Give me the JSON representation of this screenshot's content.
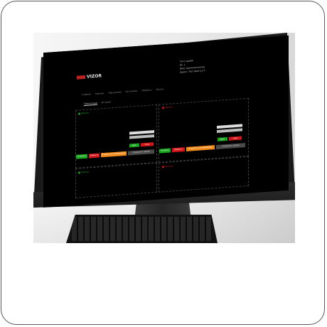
{
  "logo": {
    "text": "VIZOR"
  },
  "header_info": [
    "Тест-драйв",
    "ID: 1",
    "Имя: Администратор",
    "Адрес: Тестовая ул.3"
  ],
  "nav": [
    "Главная",
    "Камеры",
    "Нарушения",
    "Настройки",
    "Профиль",
    "Выход"
  ],
  "tabs": [
    {
      "label": "Трансляции",
      "active": true
    },
    {
      "label": "История",
      "active": false
    }
  ],
  "panels": [
    {
      "title": "Въезд",
      "status_color": "#1aa51f",
      "small_buttons": [
        {
          "label": "Open",
          "color": "green"
        },
        {
          "label": "Close",
          "color": "red"
        }
      ],
      "buttons": [
        {
          "label": "Открыть",
          "color": "green"
        },
        {
          "label": "Закрыть",
          "color": "red"
        },
        {
          "label": "Открыть и не закрывать",
          "color": "orange"
        },
        {
          "label": "Сохранить номер",
          "color": "gray"
        }
      ]
    },
    {
      "title": "Выезд",
      "status_color": "#d3161a",
      "small_buttons": [
        {
          "label": "Open",
          "color": "green"
        },
        {
          "label": "Close",
          "color": "red"
        }
      ],
      "buttons": [
        {
          "label": "Открыть",
          "color": "green"
        },
        {
          "label": "Закрыть",
          "color": "red"
        },
        {
          "label": "Открыть и не закрывать",
          "color": "orange"
        },
        {
          "label": "Сохранить номер",
          "color": "gray"
        }
      ]
    },
    {
      "title": "Въезд",
      "status_color": "#1aa51f"
    },
    {
      "title": "Выезд",
      "status_color": "#d3161a"
    }
  ]
}
